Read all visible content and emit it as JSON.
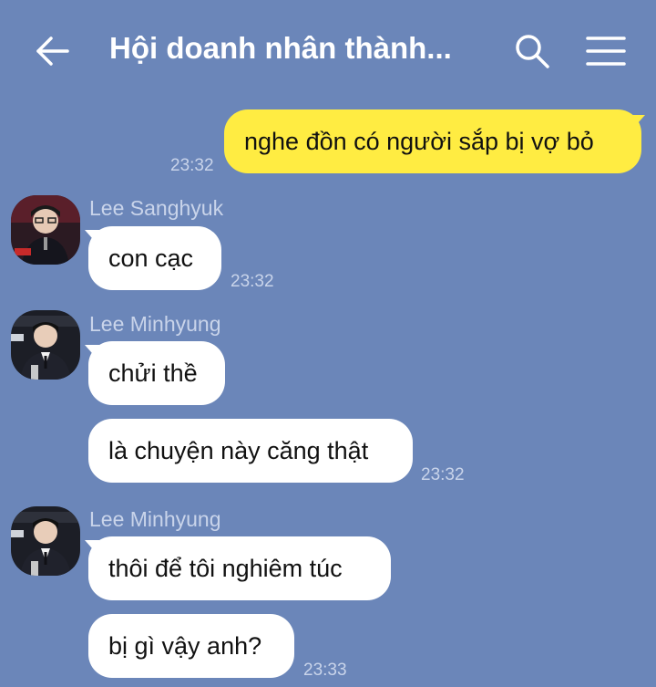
{
  "header": {
    "title": "Hội doanh nhân thành...",
    "back_icon": "arrow-left-icon",
    "search_icon": "search-icon",
    "menu_icon": "hamburger-menu-icon"
  },
  "messages": [
    {
      "type": "outgoing",
      "text": "nghe đồn có người sắp bị vợ bỏ",
      "time": "23:32"
    },
    {
      "type": "incoming",
      "sender": "Lee Sanghyuk",
      "text": "con cạc",
      "time": "23:32"
    },
    {
      "type": "incoming",
      "sender": "Lee Minhyung",
      "texts": [
        "chửi thề",
        "là chuyện này căng thật"
      ],
      "time": "23:32"
    },
    {
      "type": "incoming",
      "sender": "Lee Minhyung",
      "texts": [
        "thôi để tôi nghiêm túc",
        "bị gì vậy anh?"
      ],
      "time": "23:33"
    }
  ],
  "colors": {
    "background": "#6b86b9",
    "outgoing_bubble": "#ffec42",
    "incoming_bubble": "#ffffff",
    "meta_text": "#c9d4ea"
  }
}
